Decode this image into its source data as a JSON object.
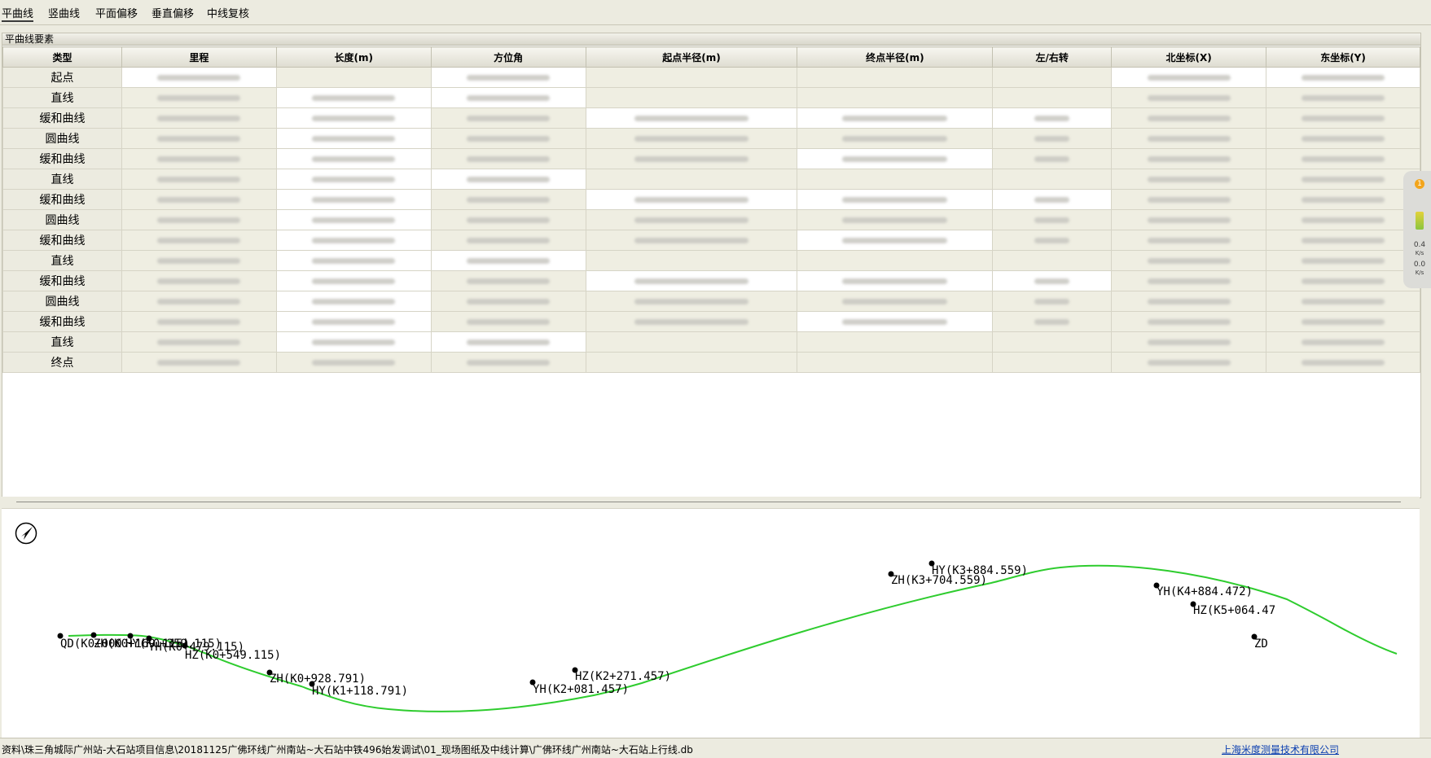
{
  "tabs": [
    "平曲线",
    "竖曲线",
    "平面偏移",
    "垂直偏移",
    "中线复核"
  ],
  "panel_title": "平曲线要素",
  "columns": [
    "类型",
    "里程",
    "长度(m)",
    "方位角",
    "起点半径(m)",
    "终点半径(m)",
    "左/右转",
    "北坐标(X)",
    "东坐标(Y)"
  ],
  "rows": [
    {
      "type": "起点"
    },
    {
      "type": "直线"
    },
    {
      "type": "缓和曲线"
    },
    {
      "type": "圆曲线"
    },
    {
      "type": "缓和曲线"
    },
    {
      "type": "直线"
    },
    {
      "type": "缓和曲线"
    },
    {
      "type": "圆曲线"
    },
    {
      "type": "缓和曲线"
    },
    {
      "type": "直线"
    },
    {
      "type": "缓和曲线"
    },
    {
      "type": "圆曲线"
    },
    {
      "type": "缓和曲线"
    },
    {
      "type": "直线"
    },
    {
      "type": "终点"
    }
  ],
  "plan": {
    "curve_color": "#2ecc2e",
    "points": [
      {
        "label": "QD(K0+000",
        "chainage": "K0+000"
      },
      {
        "label": "ZH(K0+169.115)",
        "chainage": "K0+169.115"
      },
      {
        "label": "HY(K0+359.115)",
        "chainage": "K0+359.115"
      },
      {
        "label": "YH(K0+479.115)",
        "chainage": "K0+479.115"
      },
      {
        "label": "HZ(K0+549.115)",
        "chainage": "K0+549.115"
      },
      {
        "label": "ZH(K0+928.791)",
        "chainage": "K0+928.791"
      },
      {
        "label": "HY(K1+118.791)",
        "chainage": "K1+118.791"
      },
      {
        "label": "YH(K2+081.457)",
        "chainage": "K2+081.457"
      },
      {
        "label": "HZ(K2+271.457)",
        "chainage": "K2+271.457"
      },
      {
        "label": "ZH(K3+704.559)",
        "chainage": "K3+704.559"
      },
      {
        "label": "HY(K3+884.559)",
        "chainage": "K3+884.559"
      },
      {
        "label": "YH(K4+884.472)",
        "chainage": "K4+884.472"
      },
      {
        "label": "HZ(K5+064.47",
        "chainage": "K5+064.47"
      },
      {
        "label": "ZD",
        "chainage": ""
      }
    ]
  },
  "side_widget": {
    "badge": "1",
    "up_rate": "0.4",
    "up_unit": "K/s",
    "down_rate": "0.0",
    "down_unit": "K/s"
  },
  "status": {
    "path": "资料\\珠三角城际广州站-大石站项目信息\\20181125广佛环线广州南站~大石站中铁496始发调试\\01_现场图纸及中线计算\\广佛环线广州南站~大石站上行线.db",
    "company": "上海米度测量技术有限公司"
  }
}
